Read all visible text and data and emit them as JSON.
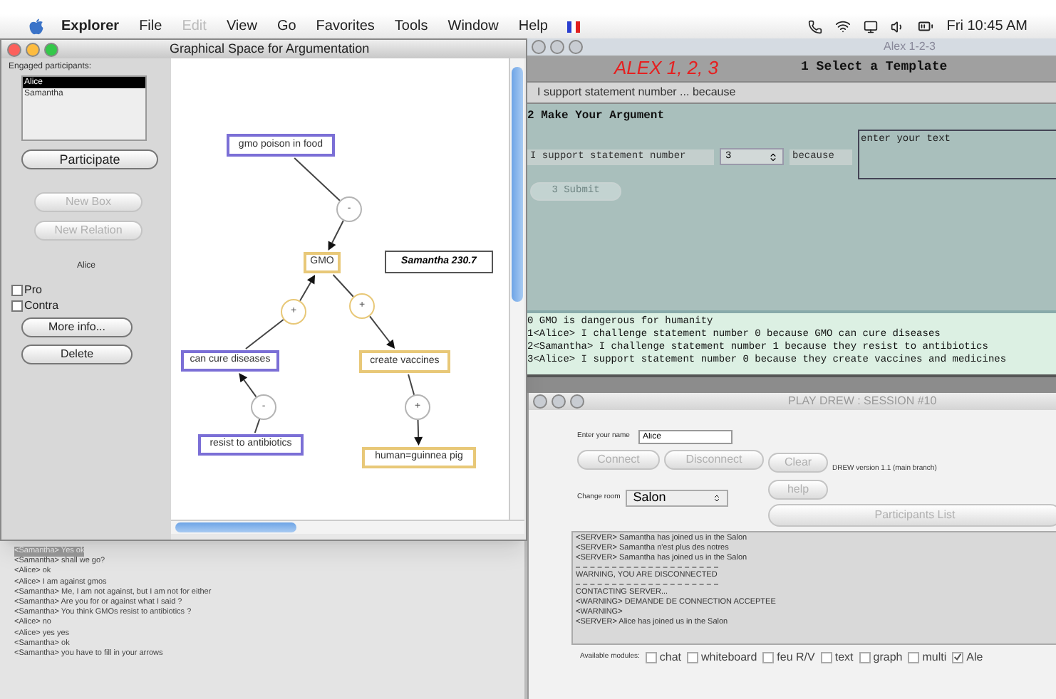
{
  "menu_bar": {
    "app": "Explorer",
    "items": [
      {
        "label": "File",
        "disabled": false
      },
      {
        "label": "Edit",
        "disabled": true
      },
      {
        "label": "View",
        "disabled": false
      },
      {
        "label": "Go",
        "disabled": false
      },
      {
        "label": "Favorites",
        "disabled": false
      },
      {
        "label": "Tools",
        "disabled": false
      },
      {
        "label": "Window",
        "disabled": false
      },
      {
        "label": "Help",
        "disabled": false
      }
    ],
    "clock": "Fri 10:45 AM"
  },
  "graph_window": {
    "title": "Graphical Space for Argumentation",
    "participants_label": "Engaged participants:",
    "participants": [
      {
        "name": "Alice",
        "selected": true
      },
      {
        "name": "Samantha",
        "selected": false
      }
    ],
    "participate_button": "Participate",
    "tool_buttons": [
      {
        "label": "New Box",
        "disabled": true
      },
      {
        "label": "New Relation",
        "disabled": true
      }
    ],
    "current_user": "Alice",
    "stances": [
      {
        "label": "Pro",
        "checked": false
      },
      {
        "label": "Contra",
        "checked": false
      }
    ],
    "action_buttons": [
      "More info...",
      "Delete"
    ],
    "nodes": [
      {
        "kind": "statement",
        "text": "gmo poison in food",
        "color": "#7b6fd6"
      },
      {
        "kind": "relation",
        "text": "-",
        "color": "#b4b4b4"
      },
      {
        "kind": "statement",
        "text": "GMO",
        "color": "#e8c878"
      },
      {
        "kind": "note",
        "text": "Samantha 230.7"
      },
      {
        "kind": "relation",
        "text": "+",
        "color": "#e8c878"
      },
      {
        "kind": "relation",
        "text": "+",
        "color": "#e8c878"
      },
      {
        "kind": "statement",
        "text": "can cure diseases",
        "color": "#7b6fd6"
      },
      {
        "kind": "statement",
        "text": "create vaccines",
        "color": "#e8c878"
      },
      {
        "kind": "relation",
        "text": "-",
        "color": "#b4b4b4"
      },
      {
        "kind": "relation",
        "text": "+",
        "color": "#b4b4b4"
      },
      {
        "kind": "statement",
        "text": "resist to antibiotics",
        "color": "#7b6fd6"
      },
      {
        "kind": "statement",
        "text": "human=guinnea pig",
        "color": "#e8c878"
      }
    ]
  },
  "chat_log": [
    {
      "text": "<Samantha> Yes ok",
      "selected": true
    },
    {
      "text": "<Samantha> shall we go?",
      "selected": false
    },
    {
      "text": "<Alice> ok",
      "selected": false
    },
    {
      "text": "<Alice> I am against gmos",
      "selected": false
    },
    {
      "text": "<Samantha> Me, I am not against, but I am not for either",
      "selected": false
    },
    {
      "text": "<Samantha> Are you for or against what I said ?",
      "selected": false
    },
    {
      "text": "<Samantha> You think GMOs resist to antibiotics ?",
      "selected": false
    },
    {
      "text": "<Alice> no",
      "selected": false
    },
    {
      "text": "<Alice> yes yes",
      "selected": false
    },
    {
      "text": "<Samantha> ok",
      "selected": false
    },
    {
      "text": "<Samantha> you have to fill in your arrows",
      "selected": false
    }
  ],
  "alex_window": {
    "title": "Alex 1-2-3",
    "logo": "ALEX 1, 2, 3",
    "step1": "1 Select a Template",
    "template": "I support statement number ... because",
    "step2": "2 Make Your Argument",
    "sentence_start": "I support statement number",
    "number": "3",
    "sentence_end": "because",
    "text_placeholder": "enter your text",
    "submit": {
      "label": "3 Submit",
      "disabled": true
    },
    "statements": [
      "0 GMO is dangerous for humanity",
      "1<Alice> I challenge statement number 0 because  GMO can cure diseases",
      "2<Samantha> I challenge statement number 1 because  they resist to antibiotics",
      "3<Alice> I support statement number 0 because  they create vaccines and medicines"
    ]
  },
  "drew_window": {
    "title": "PLAY DREW : SESSION #10",
    "name_label": "Enter your name",
    "name_value": "Alice",
    "buttons": [
      {
        "label": "Connect",
        "disabled": true
      },
      {
        "label": "Disconnect",
        "disabled": true
      },
      {
        "label": "Clear",
        "disabled": true
      }
    ],
    "help_button": "help",
    "version": "DREW version 1.1 (main branch)",
    "room_label": "Change room",
    "room": "Salon",
    "participants_button": "Participants List",
    "log": [
      {
        "kind": "line",
        "text": "<SERVER> Samantha has joined us in the Salon"
      },
      {
        "kind": "line",
        "text": "<SERVER> Samantha n'est plus des notres"
      },
      {
        "kind": "line",
        "text": "<SERVER> Samantha has joined us in the Salon"
      },
      {
        "kind": "rule"
      },
      {
        "kind": "line",
        "text": "WARNING, YOU ARE DISCONNECTED"
      },
      {
        "kind": "rule"
      },
      {
        "kind": "line",
        "text": "CONTACTING SERVER..."
      },
      {
        "kind": "line",
        "text": "<WARNING> DEMANDE DE CONNECTION ACCEPTEE"
      },
      {
        "kind": "line",
        "text": "<WARNING>"
      },
      {
        "kind": "line",
        "text": "<SERVER> Alice has joined us in the Salon"
      }
    ],
    "modules_label": "Available modules:",
    "modules": [
      {
        "label": "chat",
        "checked": false
      },
      {
        "label": "whiteboard",
        "checked": false
      },
      {
        "label": "feu R/V",
        "checked": false
      },
      {
        "label": "text",
        "checked": false
      },
      {
        "label": "graph",
        "checked": false
      },
      {
        "label": "multi",
        "checked": false
      },
      {
        "label": "Ale",
        "checked": true
      }
    ]
  }
}
